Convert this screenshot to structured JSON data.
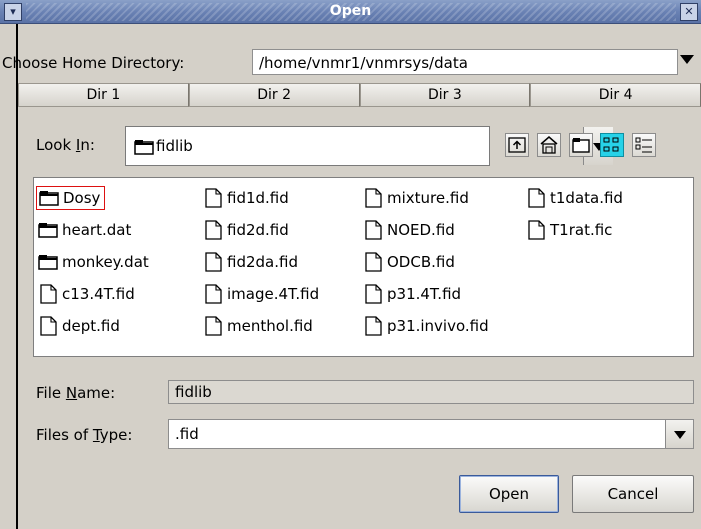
{
  "window": {
    "title": "Open"
  },
  "home": {
    "label": "Choose Home Directory:",
    "value": "/home/vnmr1/vnmrsys/data"
  },
  "dir_tabs": [
    "Dir 1",
    "Dir 2",
    "Dir 3",
    "Dir 4"
  ],
  "lookin": {
    "label_pre": "Look ",
    "label_mnemonic": "I",
    "label_post": "n:",
    "value": "fidlib"
  },
  "toolbar": {
    "icons": [
      "up-folder-icon",
      "home-icon",
      "new-folder-icon",
      "list-view-icon",
      "details-view-icon"
    ],
    "active": "list-view-icon"
  },
  "files": [
    {
      "name": "Dosy",
      "type": "folder",
      "selected": true
    },
    {
      "name": "heart.dat",
      "type": "folder"
    },
    {
      "name": "monkey.dat",
      "type": "folder"
    },
    {
      "name": "c13.4T.fid",
      "type": "file"
    },
    {
      "name": "dept.fid",
      "type": "file"
    },
    {
      "name": "fid1d.fid",
      "type": "file"
    },
    {
      "name": "fid2d.fid",
      "type": "file"
    },
    {
      "name": "fid2da.fid",
      "type": "file"
    },
    {
      "name": "image.4T.fid",
      "type": "file"
    },
    {
      "name": "menthol.fid",
      "type": "file"
    },
    {
      "name": "mixture.fid",
      "type": "file"
    },
    {
      "name": "NOED.fid",
      "type": "file"
    },
    {
      "name": "ODCB.fid",
      "type": "file"
    },
    {
      "name": "p31.4T.fid",
      "type": "file"
    },
    {
      "name": "p31.invivo.fid",
      "type": "file"
    },
    {
      "name": "t1data.fid",
      "type": "file"
    },
    {
      "name": "T1rat.fic",
      "type": "file"
    }
  ],
  "filename": {
    "label_pre": "File ",
    "label_mnemonic": "N",
    "label_post": "ame:",
    "value": "fidlib"
  },
  "filetype": {
    "label_pre": "Files of ",
    "label_mnemonic": "T",
    "label_post": "ype:",
    "value": ".fid"
  },
  "buttons": {
    "open": "Open",
    "cancel": "Cancel"
  },
  "colors": {
    "titlebar": "#6a82b4",
    "selection_border": "#dd1111",
    "active_tool": "#27d2e8"
  }
}
